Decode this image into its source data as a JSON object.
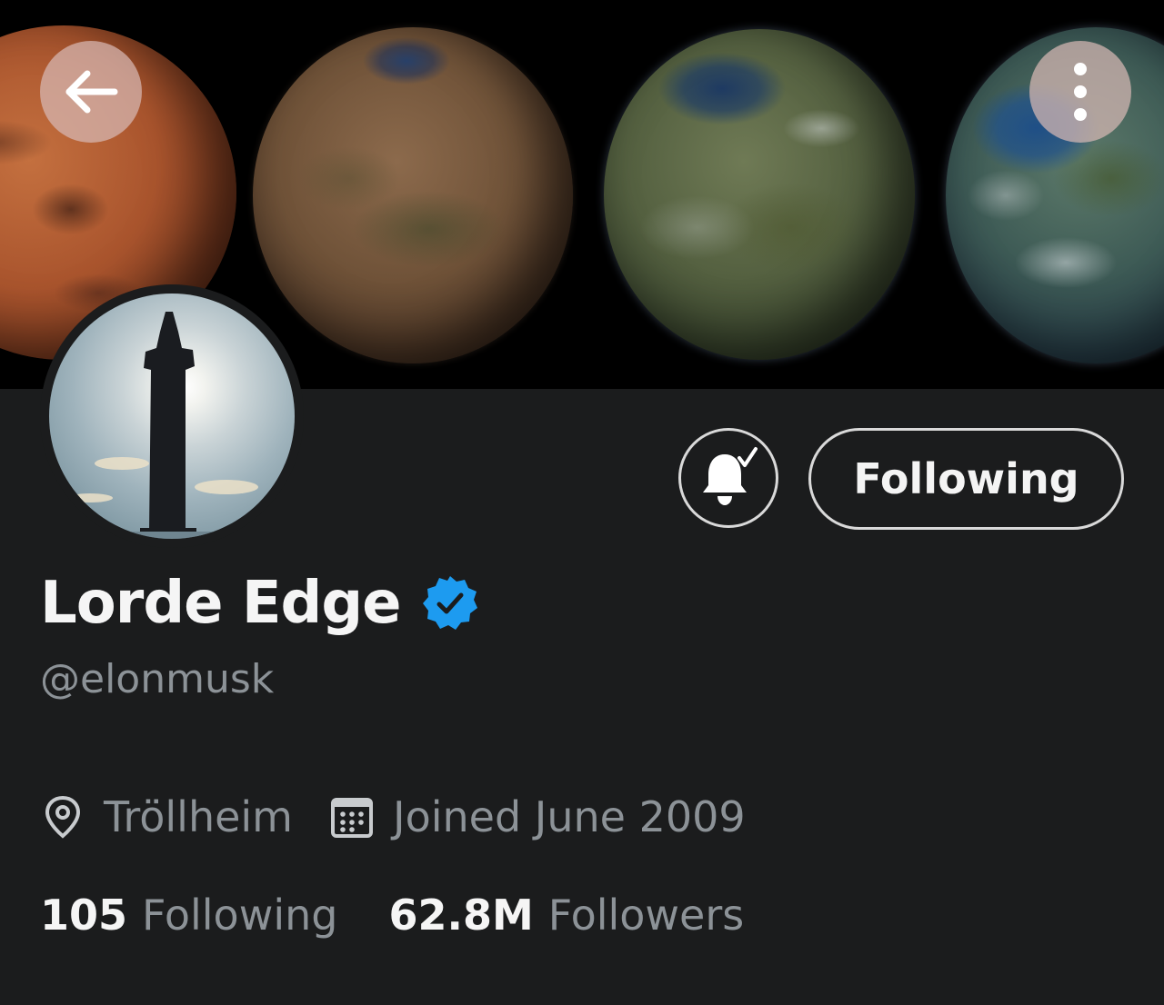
{
  "profile": {
    "display_name": "Lorde Edge",
    "handle": "@elonmusk",
    "location": "Tröllheim",
    "joined": "Joined June 2009",
    "verified": true
  },
  "actions": {
    "following_label": "Following"
  },
  "stats": {
    "following_count": "105",
    "following_label": "Following",
    "followers_count": "62.8M",
    "followers_label": "Followers"
  },
  "icons": {
    "back": "arrow-left-icon",
    "more": "more-vertical-icon",
    "bell": "bell-check-icon",
    "verified": "verified-badge-icon",
    "location": "location-pin-icon",
    "calendar": "calendar-icon"
  },
  "colors": {
    "background": "#1b1c1d",
    "verified_blue": "#1d9bf0",
    "text_primary": "#f5f5f5",
    "text_secondary": "#8c9297"
  }
}
